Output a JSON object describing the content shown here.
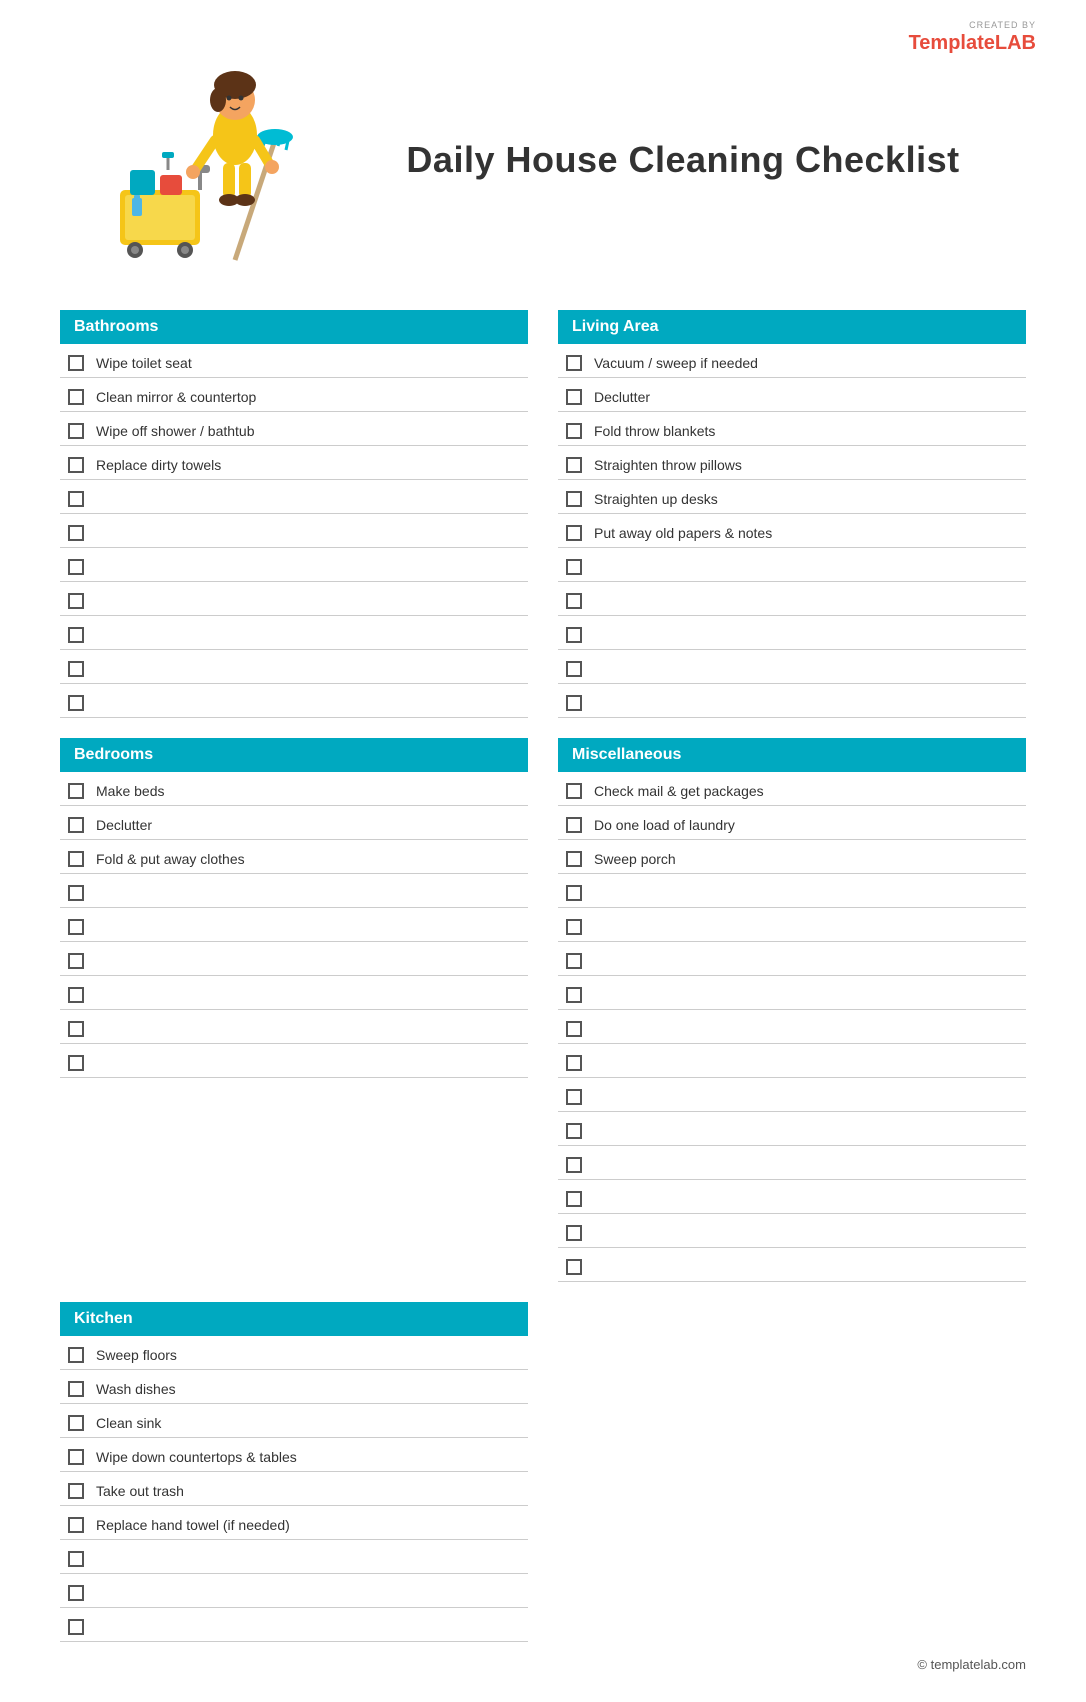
{
  "logo": {
    "created_by": "CREATED BY",
    "brand_part1": "Template",
    "brand_part2": "LAB"
  },
  "title": "Daily House Cleaning Checklist",
  "sections": {
    "bathrooms": {
      "label": "Bathrooms",
      "items": [
        "Wipe toilet seat",
        "Clean mirror & countertop",
        "Wipe off shower / bathtub",
        "Replace dirty towels",
        "",
        "",
        "",
        "",
        "",
        "",
        ""
      ]
    },
    "living_area": {
      "label": "Living Area",
      "items": [
        "Vacuum / sweep if needed",
        "Declutter",
        "Fold throw blankets",
        "Straighten throw pillows",
        "Straighten up desks",
        "Put away old papers & notes",
        "",
        "",
        "",
        "",
        ""
      ]
    },
    "bedrooms": {
      "label": "Bedrooms",
      "items": [
        "Make beds",
        "Declutter",
        "Fold & put away clothes",
        "",
        "",
        "",
        "",
        "",
        ""
      ]
    },
    "miscellaneous": {
      "label": "Miscellaneous",
      "items": [
        "Check mail & get packages",
        "Do one load of laundry",
        "Sweep porch",
        "",
        "",
        "",
        "",
        "",
        "",
        "",
        "",
        "",
        "",
        "",
        ""
      ]
    },
    "kitchen": {
      "label": "Kitchen",
      "items": [
        "Sweep floors",
        "Wash dishes",
        "Clean sink",
        "Wipe down countertops & tables",
        "Take out trash",
        "Replace hand towel (if needed)",
        "",
        "",
        ""
      ]
    }
  },
  "footer": {
    "text": "© templatelab.com"
  }
}
